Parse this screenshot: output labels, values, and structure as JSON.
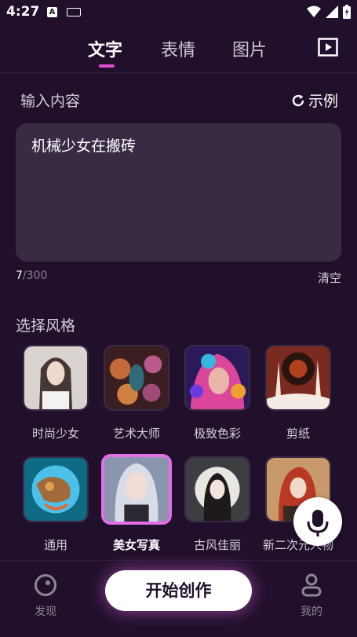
{
  "status": {
    "time": "4:27"
  },
  "tabs": [
    {
      "label": "文字",
      "active": true
    },
    {
      "label": "表情",
      "active": false
    },
    {
      "label": "图片",
      "active": false
    }
  ],
  "input": {
    "label": "输入内容",
    "example_label": "示例",
    "value": "机械少女在搬砖",
    "count": "7",
    "max": "/300",
    "clear_label": "清空"
  },
  "styles": {
    "title": "选择风格",
    "items": [
      {
        "name": "时尚少女",
        "selected": false,
        "color": "#c9c2c0"
      },
      {
        "name": "艺术大师",
        "selected": false,
        "color": "#7a3b3a"
      },
      {
        "name": "极致色彩",
        "selected": false,
        "color": "#5e3cb6"
      },
      {
        "name": "剪纸",
        "selected": false,
        "color": "#7c2a20"
      },
      {
        "name": "通用",
        "selected": false,
        "color": "#2e7fa2"
      },
      {
        "name": "美女写真",
        "selected": true,
        "color": "#7a8aa8"
      },
      {
        "name": "古风佳丽",
        "selected": false,
        "color": "#4a4a4e"
      },
      {
        "name": "新二次元人物",
        "selected": false,
        "color": "#9a3a2a"
      }
    ]
  },
  "bottom_nav": {
    "discover": "发现",
    "start": "开始创作",
    "mine": "我的"
  },
  "colors": {
    "background": "#21102c",
    "accent": "#e46ee8",
    "textbox": "#3a2b44"
  }
}
